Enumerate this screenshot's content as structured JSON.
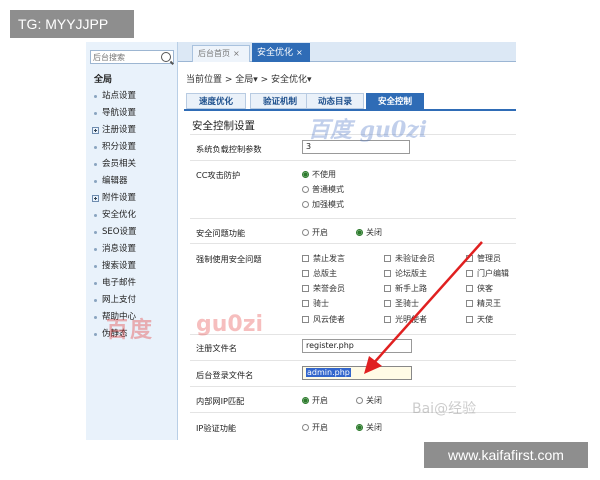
{
  "badges": {
    "tg": "TG: MYYJJPP",
    "site": "www.kaifafirst.com"
  },
  "sidebar": {
    "search_placeholder": "后台搜索",
    "title": "全局",
    "items": [
      {
        "label": "站点设置",
        "icon": "bullet"
      },
      {
        "label": "导航设置",
        "icon": "bullet"
      },
      {
        "label": "注册设置",
        "icon": "plus"
      },
      {
        "label": "积分设置",
        "icon": "bullet"
      },
      {
        "label": "会员相关",
        "icon": "bullet"
      },
      {
        "label": "编辑器",
        "icon": "bullet"
      },
      {
        "label": "附件设置",
        "icon": "plus"
      },
      {
        "label": "安全优化",
        "icon": "bullet"
      },
      {
        "label": "SEO设置",
        "icon": "bullet"
      },
      {
        "label": "消息设置",
        "icon": "bullet"
      },
      {
        "label": "搜索设置",
        "icon": "bullet"
      },
      {
        "label": "电子邮件",
        "icon": "bullet"
      },
      {
        "label": "网上支付",
        "icon": "bullet"
      },
      {
        "label": "帮助中心",
        "icon": "bullet"
      },
      {
        "label": "伪静态",
        "icon": "bullet"
      }
    ]
  },
  "topbar": {
    "tab_home": "后台首页",
    "tab_active": "安全优化",
    "close": "×"
  },
  "breadcrumb": "当前位置 > 全局▾ > 安全优化▾",
  "subtabs": [
    "速度优化",
    "验证机制",
    "动态目录",
    "安全控制"
  ],
  "section_title": "安全控制设置",
  "form": {
    "load_label": "系统负载控制参数",
    "load_value": "3",
    "cc_label": "CC攻击防护",
    "cc_options": [
      "不使用",
      "普通模式",
      "加强模式"
    ],
    "question_label": "安全问题功能",
    "open": "开启",
    "close": "关闭",
    "force_label": "强制使用安全问题",
    "groups": [
      "禁止发言",
      "未验证会员",
      "管理员",
      "总版主",
      "论坛版主",
      "门户编辑",
      "荣誉会员",
      "新手上路",
      "侠客",
      "骑士",
      "圣骑士",
      "精灵王",
      "风云使者",
      "光明使者",
      "天使"
    ],
    "reg_label": "注册文件名",
    "reg_value": "register.php",
    "admin_label": "后台登录文件名",
    "admin_value": "admin.php",
    "lan_label": "内部网IP匹配",
    "ip_label": "IP验证功能"
  },
  "watermarks": {
    "red_a": "百度",
    "red_b": "gu0zi",
    "blue": "百度 gu0zi",
    "gray": "Bai@经验"
  },
  "colors": {
    "accent": "#2f6cb6",
    "arrow": "#e02020"
  }
}
